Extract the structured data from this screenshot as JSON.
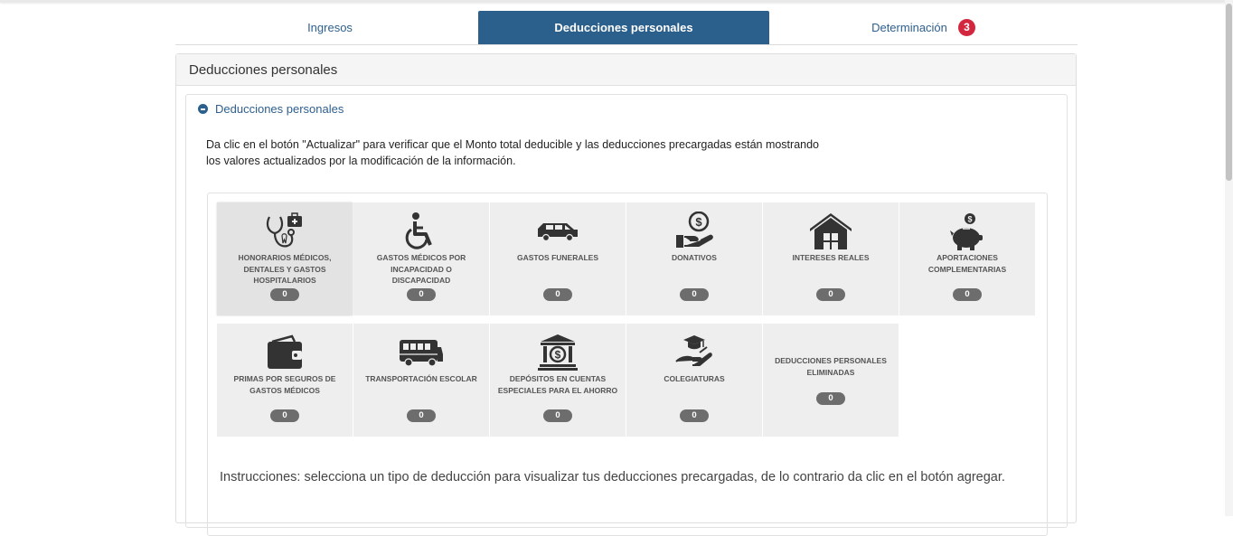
{
  "tabs": {
    "ingresos": "Ingresos",
    "deducciones": "Deducciones personales",
    "determinacion": "Determinación",
    "determinacion_badge": "3"
  },
  "panel": {
    "title": "Deducciones personales",
    "section_title": "Deducciones personales",
    "intro_line1": "Da clic en el botón \"Actualizar\" para verificar que el Monto total deducible y las deducciones precargadas están mostrando",
    "intro_line2": "los valores actualizados por la modificación de la información."
  },
  "cards": [
    {
      "label": "HONORARIOS MÉDICOS, DENTALES Y GASTOS HOSPITALARIOS",
      "count": "0",
      "icon": "stethoscope-icon"
    },
    {
      "label": "GASTOS MÉDICOS POR INCAPACIDAD O DISCAPACIDAD",
      "count": "0",
      "icon": "wheelchair-icon"
    },
    {
      "label": "GASTOS FUNERALES",
      "count": "0",
      "icon": "hearse-icon"
    },
    {
      "label": "DONATIVOS",
      "count": "0",
      "icon": "donation-icon"
    },
    {
      "label": "INTERESES REALES",
      "count": "0",
      "icon": "house-icon"
    },
    {
      "label": "APORTACIONES COMPLEMENTARIAS",
      "count": "0",
      "icon": "piggy-bank-icon"
    },
    {
      "label": "PRIMAS POR SEGUROS DE GASTOS MÉDICOS",
      "count": "0",
      "icon": "wallet-icon"
    },
    {
      "label": "TRANSPORTACIÓN ESCOLAR",
      "count": "0",
      "icon": "school-bus-icon"
    },
    {
      "label": "DEPÓSITOS EN CUENTAS ESPECIALES PARA EL AHORRO",
      "count": "0",
      "icon": "bank-icon"
    },
    {
      "label": "COLEGIATURAS",
      "count": "0",
      "icon": "graduation-cap-icon"
    },
    {
      "label": "DEDUCCIONES PERSONALES ELIMINADAS",
      "count": "0",
      "icon": ""
    }
  ],
  "instructions": "Instrucciones: selecciona un tipo de deducción para visualizar tus deducciones precargadas, de lo contrario da clic en el botón agregar.",
  "colors": {
    "accent": "#2b5f8c",
    "badge": "#d3273f",
    "card_bg": "#eeeeee",
    "count_pill": "#6d6d6d"
  }
}
